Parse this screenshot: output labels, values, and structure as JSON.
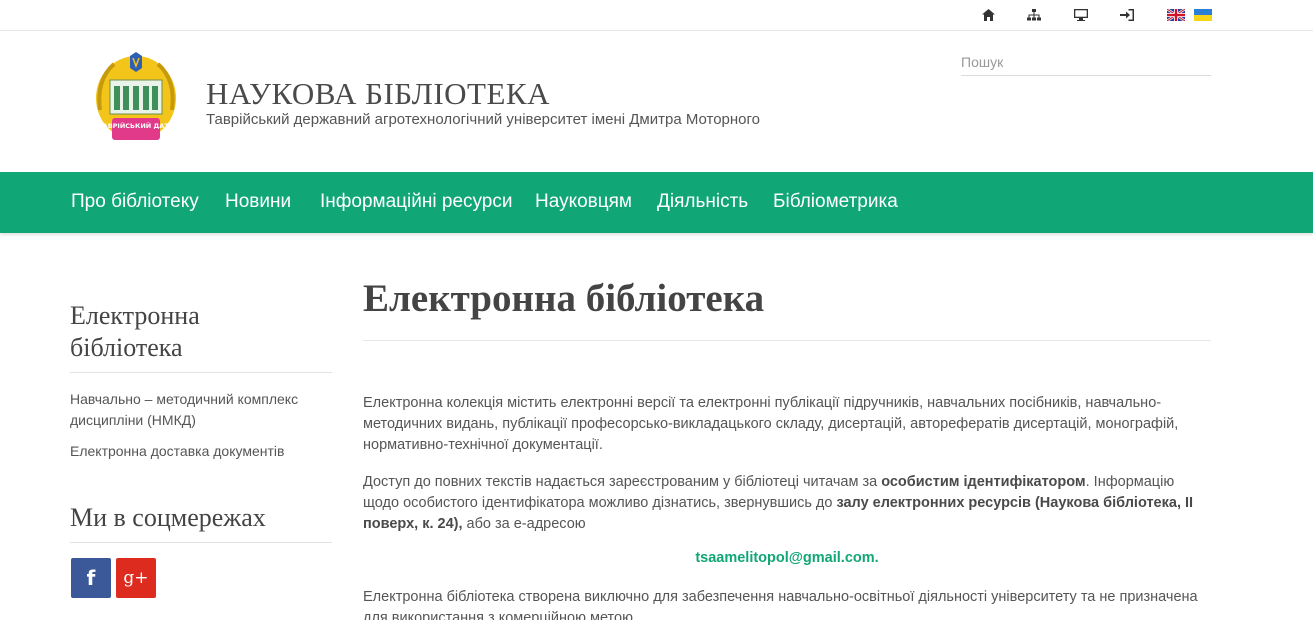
{
  "topbar": {
    "icons": [
      "home-icon",
      "sitemap-icon",
      "monitor-icon",
      "login-icon"
    ],
    "flags": [
      "uk-flag",
      "ukraine-flag"
    ]
  },
  "header": {
    "logo_text": "ТАВРІЙСЬКИЙ ДАТУ",
    "title": "НАУКОВА БІБЛІОТЕКА",
    "subtitle": "Таврійський державний агротехнологічний університет імені Дмитра Моторного",
    "search_placeholder": "Пошук"
  },
  "nav": {
    "items": [
      "Про бібліотеку",
      "Новини",
      "Інформаційні ресурси",
      "Науковцям",
      "Діяльність",
      "Бібліометрика"
    ]
  },
  "sidebar": {
    "heading1_line1": "Електронна",
    "heading1_line2": "бібліотека",
    "link1": "Навчально – методичний комплекс дисципліни (НМКД)",
    "link2": "Електронна доставка документів",
    "heading2": "Ми в соцмережах",
    "facebook_glyph": "f",
    "google_glyph": "g+"
  },
  "main": {
    "title": "Електронна бібліотека",
    "p1": "Електронна колекція містить електронні версії та електронні публікації підручників, навчальних посібників, навчально-методичних видань, публікації професорсько-викладацького складу, дисертацій, авторефератів дисертацій, монографій, нормативно-технічної документації.",
    "p2_a": "Доступ до повних текстів надається зареєстрованим у бібліотеці читачам за ",
    "p2_b": "особистим ідентифікатором",
    "p2_c": ". Інформацію щодо особистого ідентифікатора можливо дізнатись, звернувшись до ",
    "p2_d": "залу електронних ресурсів",
    "p2_e": " ",
    "p2_f": "(Наукова бібліотека, ІІ поверх, к. 24),",
    "p2_g": " або за е-адресою",
    "email": "tsaamelitopol@gmail.com.",
    "p3": "Електронна бібліотека створена виключно для забезпечення навчально-освітньої діяльності університету та не призначена для використання з комерційною метою"
  },
  "colors": {
    "accent": "#11a676",
    "facebook": "#3b5998",
    "google": "#dd2c1f"
  }
}
